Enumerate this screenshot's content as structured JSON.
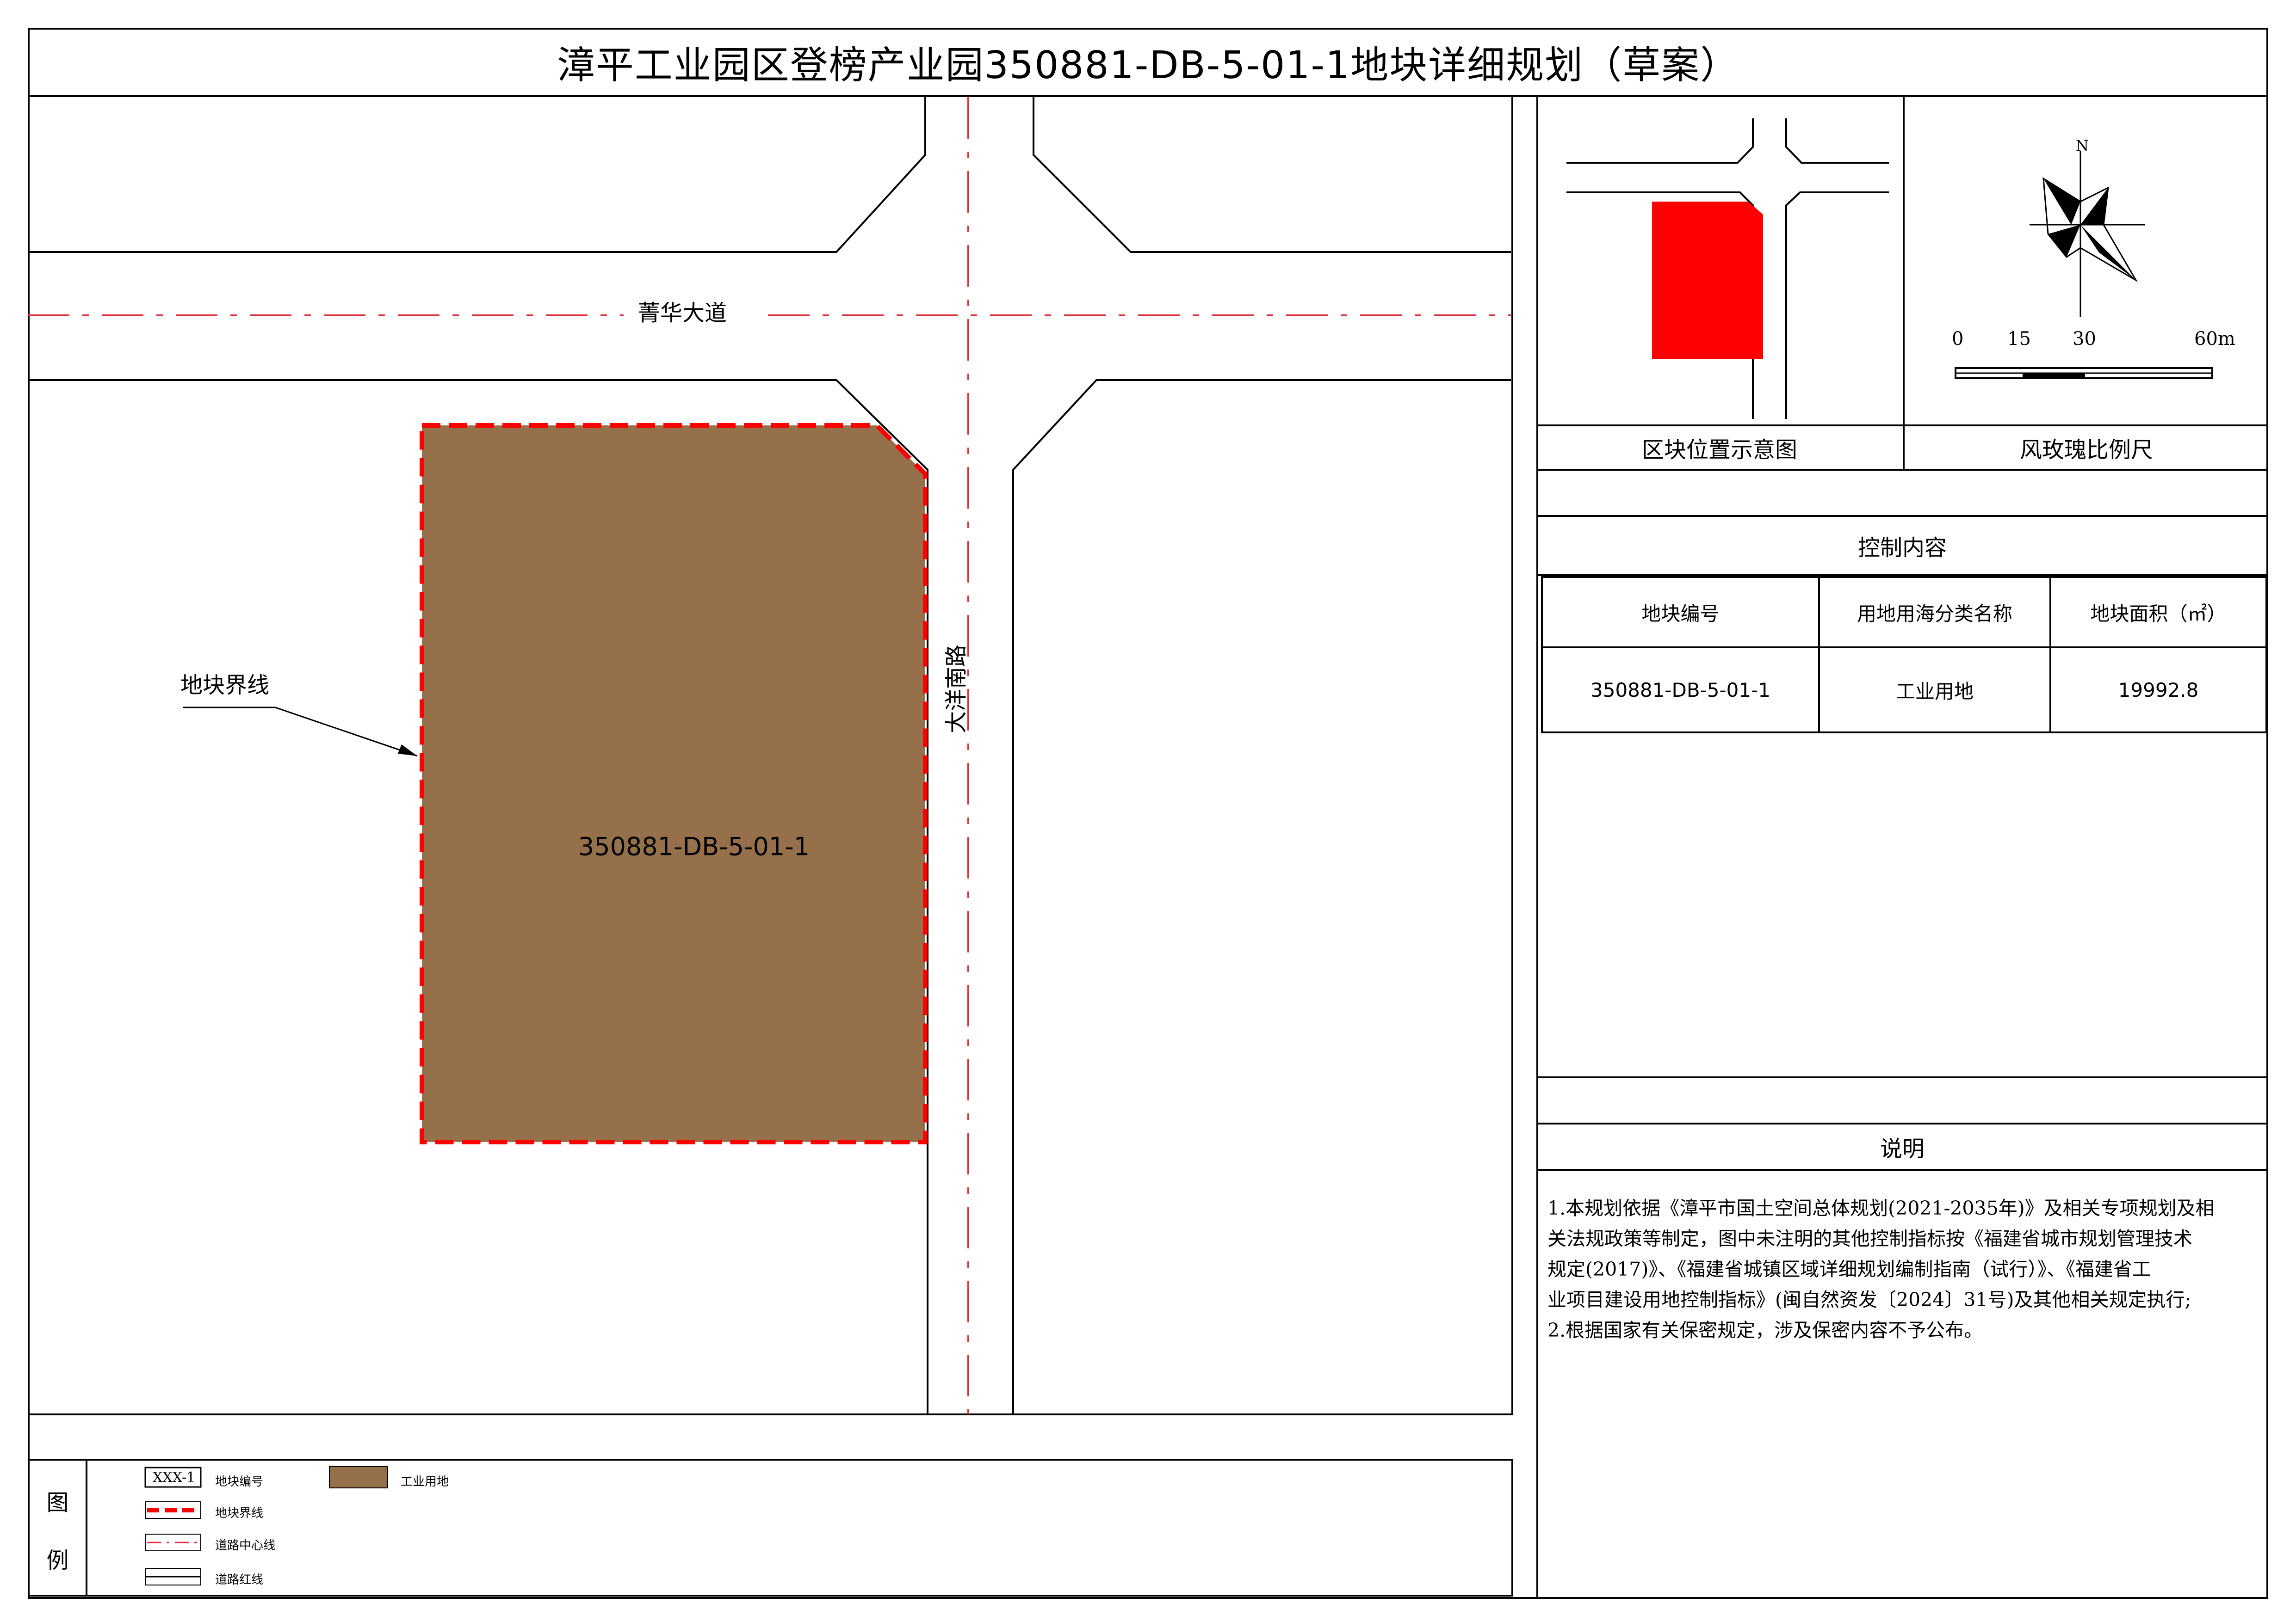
{
  "title": "漳平工业园区登榜产业园350881-DB-5-01-1地块详细规划（草案）",
  "map": {
    "road_horizontal": "菁华大道",
    "road_vertical": "大洋南路",
    "parcel_id": "350881-DB-5-01-1",
    "boundary_callout": "地块界线",
    "colors": {
      "parcel_fill": "#96704A",
      "boundary": "#FF0000",
      "centerline": "#E0303A"
    }
  },
  "location_panel": {
    "caption": "区块位置示意图",
    "highlight_color": "#FF0000"
  },
  "rose_panel": {
    "caption": "风玫瑰比例尺",
    "north_label": "N",
    "scale_labels": [
      "0",
      "15",
      "30",
      "60m"
    ]
  },
  "control": {
    "header": "控制内容",
    "columns": [
      "地块编号",
      "用地用海分类名称",
      "地块面积（㎡）"
    ],
    "rows": [
      [
        "350881-DB-5-01-1",
        "工业用地",
        "19992.8"
      ]
    ]
  },
  "notes": {
    "header": "说明",
    "lines": [
      "1.本规划依据《漳平市国土空间总体规划(2021-2035年)》及相关专项规划及相",
      "关法规政策等制定，图中未注明的其他控制指标按《福建省城市规划管理技术",
      "规定(2017)》、《福建省城镇区域详细规划编制指南（试行）》、《福建省工",
      "业项目建设用地控制指标》(闽自然资发〔2024〕31号)及其他相关规定执行;",
      "2.根据国家有关保密规定，涉及保密内容不予公布。"
    ]
  },
  "legend": {
    "header_top": "图",
    "header_bottom": "例",
    "parcel_code_sample": "XXX-1",
    "items": {
      "parcel_code": "地块编号",
      "boundary": "地块界线",
      "centerline": "道路中心线",
      "red_line": "道路红线",
      "industrial": "工业用地"
    }
  }
}
